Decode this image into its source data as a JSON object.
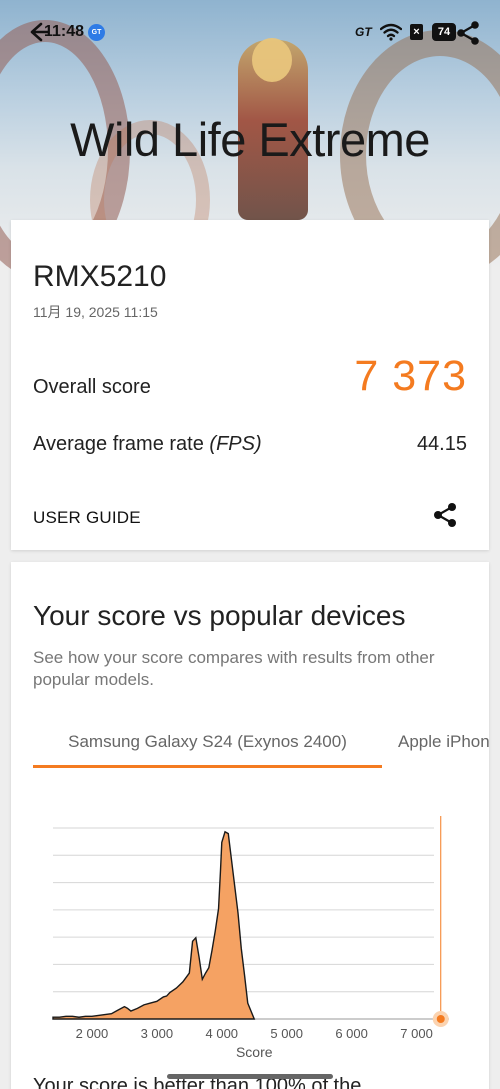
{
  "status_bar": {
    "time": "11:48",
    "gt_badge": "GT",
    "gt_label": "GT",
    "notification_badge": "×",
    "battery": "74"
  },
  "hero": {
    "title": "Wild Life Extreme"
  },
  "result": {
    "device": "RMX5210",
    "date": "11月 19, 2025 11:15",
    "overall_label": "Overall score",
    "overall_value": "7 373",
    "fps_label": "Average frame rate",
    "fps_unit": "(FPS)",
    "fps_value": "44.15",
    "guide_label": "USER GUIDE"
  },
  "compare": {
    "title": "Your score vs popular devices",
    "subtitle": "See how your score compares with results from other popular models.",
    "tabs": [
      {
        "label": "Samsung Galaxy S24 (Exynos 2400)",
        "active": true
      },
      {
        "label": "Apple iPhone",
        "active": false
      }
    ],
    "bottom_text": "Your score is better than 100% of the"
  },
  "chart_data": {
    "type": "area",
    "title": "",
    "xlabel": "Score",
    "ylabel": "",
    "xlim": [
      1400,
      7500
    ],
    "x_ticks": [
      "2 000",
      "3 000",
      "4 000",
      "5 000",
      "6 000",
      "7 000"
    ],
    "tick_values": [
      2000,
      3000,
      4000,
      5000,
      6000,
      7000
    ],
    "grid": true,
    "distribution": {
      "x": [
        1400,
        1500,
        1600,
        1700,
        1800,
        1900,
        2000,
        2100,
        2200,
        2300,
        2400,
        2500,
        2550,
        2600,
        2700,
        2800,
        2900,
        3000,
        3100,
        3150,
        3200,
        3300,
        3400,
        3500,
        3550,
        3600,
        3650,
        3700,
        3750,
        3800,
        3850,
        3900,
        3950,
        3980,
        4000,
        4050,
        4100,
        4150,
        4200,
        4250,
        4300,
        4350,
        4400,
        4500
      ],
      "y": [
        2,
        2,
        3,
        3,
        2,
        3,
        3,
        4,
        5,
        6,
        10,
        14,
        12,
        9,
        12,
        16,
        18,
        20,
        25,
        26,
        30,
        35,
        42,
        52,
        88,
        92,
        70,
        45,
        52,
        58,
        78,
        100,
        125,
        168,
        200,
        212,
        210,
        180,
        150,
        120,
        80,
        50,
        18,
        0
      ]
    },
    "marker": {
      "label": "Your score",
      "value": 7373,
      "color": "#f47b20"
    },
    "fill_color": "#f5a263",
    "stroke_color": "#1a1a1a"
  },
  "colors": {
    "accent": "#f47b20"
  }
}
